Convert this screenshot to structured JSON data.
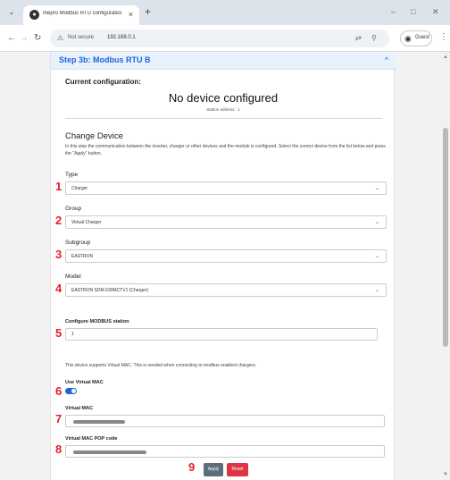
{
  "browser": {
    "tab_title": "Inepro Modbus RTU configuration",
    "tab_close": "×",
    "new_tab": "+",
    "window_min": "–",
    "window_max": "□",
    "window_close": "✕",
    "security_label": "Not secure",
    "url": "192.168.0.1",
    "profile_label": "Guest"
  },
  "card": {
    "title": "Step 3b: Modbus RTU B",
    "current_config_title": "Current configuration:",
    "no_device": "No device configured",
    "station_address": "Station address : 1",
    "change_device_title": "Change Device",
    "description": "In this step the communication between the inverter, charger or other devices and the module is configured. Select the correct device from the list below and press the \"Apply\" button."
  },
  "fields": {
    "type_label": "Type",
    "type_value": "Charger",
    "group_label": "Group",
    "group_value": "Virtual Charger",
    "subgroup_label": "Subgroup",
    "subgroup_value": "EASTRON",
    "model_label": "Model",
    "model_value": "EASTRON SDM 630MCTV1 (Charger)",
    "station_label": "Configure MODBUS station",
    "station_value": "1",
    "virtual_mac_info": "This device supports Virtual MAC. This is needed when connecting to modbus enabled chargers.",
    "use_virtual_mac_label": "Use Virtual MAC",
    "use_virtual_mac_on": true,
    "virtual_mac_label": "Virtual MAC",
    "virtual_mac_pop_label": "Virtual MAC POP code"
  },
  "buttons": {
    "apply": "Apply",
    "reset": "Reset"
  },
  "markers": [
    "1",
    "2",
    "3",
    "4",
    "5",
    "6",
    "7",
    "8",
    "9"
  ],
  "colors": {
    "accent": "#1a66d8",
    "marker": "#e31e24",
    "reset": "#dc3545",
    "apply": "#5d6d7c"
  }
}
